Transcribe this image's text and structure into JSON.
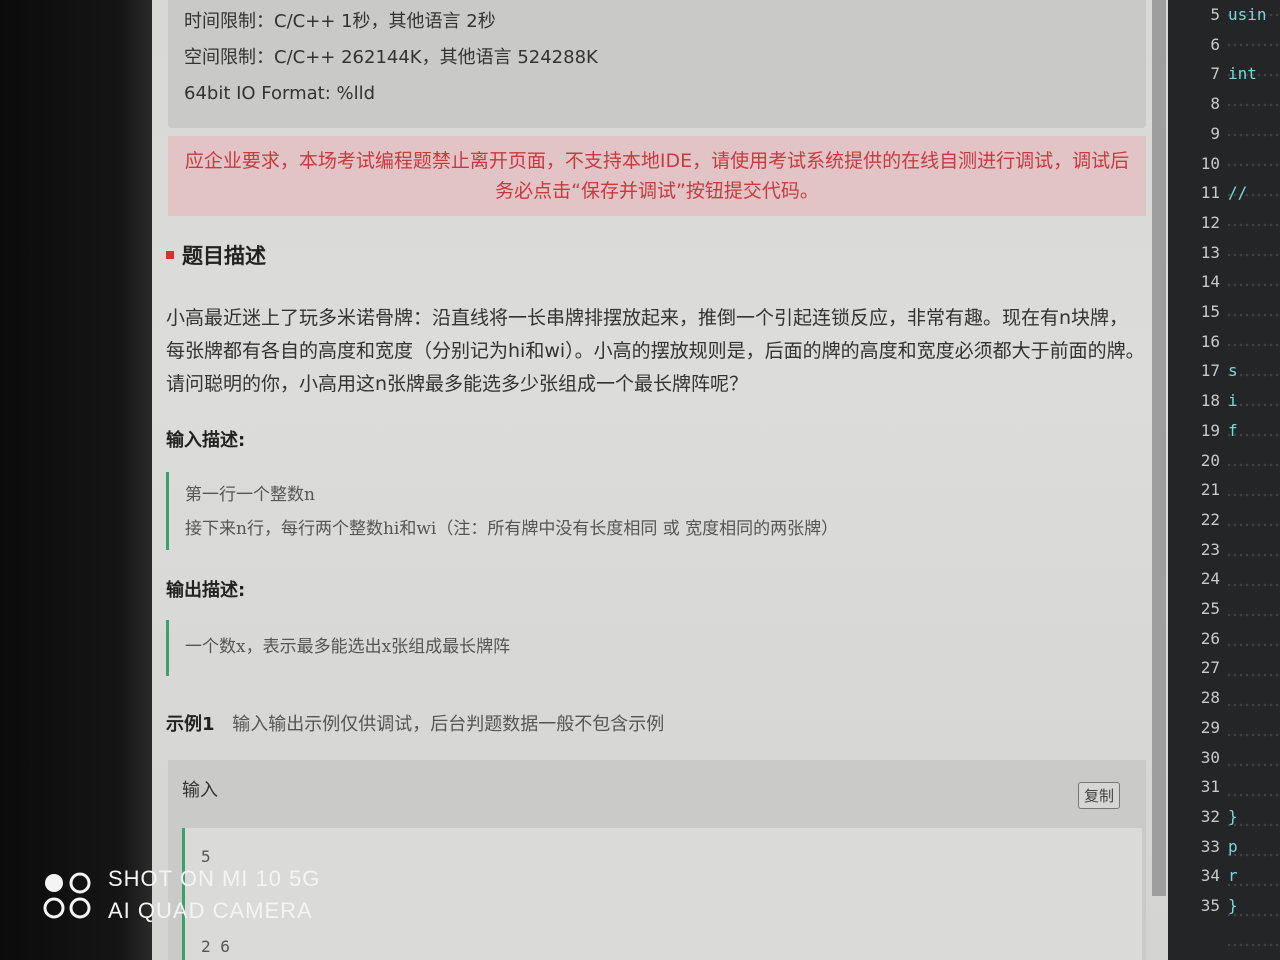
{
  "limits": {
    "time": "时间限制：C/C++ 1秒，其他语言 2秒",
    "memory": "空间限制：C/C++ 262144K，其他语言 524288K",
    "io": "64bit IO Format: %lld"
  },
  "alert": {
    "text": "应企业要求，本场考试编程题禁止离开页面，不支持本地IDE，请使用考试系统提供的在线自测进行调试，调试后务必点击“保存并调试”按钮提交代码。"
  },
  "problem": {
    "title": "题目描述",
    "description": "小高最近迷上了玩多米诺骨牌：沿直线将一长串牌排摆放起来，推倒一个引起连锁反应，非常有趣。现在有n块牌，每张牌都有各自的高度和宽度（分别记为hi和wi）。小高的摆放规则是，后面的牌的高度和宽度必须都大于前面的牌。请问聪明的你，小高用这n张牌最多能选多少张组成一个最长牌阵呢？",
    "input_title": "输入描述:",
    "input_lines": [
      "第一行一个整数n",
      "接下来n行，每行两个整数hi和wi（注：所有牌中没有长度相同 或 宽度相同的两张牌）"
    ],
    "output_title": "输出描述:",
    "output_lines": [
      "一个数x，表示最多能选出x张组成最长牌阵"
    ]
  },
  "example": {
    "label": "示例1",
    "note": "输入输出示例仅供调试，后台判题数据一般不包含示例",
    "input_label": "输入",
    "copy_label": "复制",
    "input_lines": [
      "5",
      "",
      "",
      "2 6"
    ]
  },
  "editor": {
    "lines": [
      {
        "num": "5",
        "code": "usin"
      },
      {
        "num": "6",
        "code": ""
      },
      {
        "num": "7",
        "code": "int"
      },
      {
        "num": "8",
        "code": ""
      },
      {
        "num": "9",
        "code": ""
      },
      {
        "num": "10",
        "code": ""
      },
      {
        "num": "11",
        "code": "//"
      },
      {
        "num": "12",
        "code": ""
      },
      {
        "num": "13",
        "code": ""
      },
      {
        "num": "14",
        "code": ""
      },
      {
        "num": "15",
        "code": ""
      },
      {
        "num": "16",
        "code": ""
      },
      {
        "num": "17",
        "code": "s"
      },
      {
        "num": "18",
        "code": "i"
      },
      {
        "num": "19",
        "code": "f"
      },
      {
        "num": "20",
        "code": ""
      },
      {
        "num": "21",
        "code": ""
      },
      {
        "num": "22",
        "code": ""
      },
      {
        "num": "23",
        "code": ""
      },
      {
        "num": "24",
        "code": ""
      },
      {
        "num": "25",
        "code": ""
      },
      {
        "num": "26",
        "code": ""
      },
      {
        "num": "27",
        "code": ""
      },
      {
        "num": "28",
        "code": ""
      },
      {
        "num": "29",
        "code": ""
      },
      {
        "num": "30",
        "code": ""
      },
      {
        "num": "31",
        "code": ""
      },
      {
        "num": "32",
        "code": "}"
      },
      {
        "num": "33",
        "code": "p"
      },
      {
        "num": "34",
        "code": "r"
      },
      {
        "num": "35",
        "code": "}"
      }
    ]
  },
  "watermark": {
    "line1": "SHOT ON MI 10 5G",
    "line2": "AI QUAD CAMERA"
  },
  "colors": {
    "alert_text": "#c83a3f",
    "alert_bg": "#e2c4c6",
    "accent_green": "#3aa06c",
    "title_marker": "#d9302f"
  }
}
